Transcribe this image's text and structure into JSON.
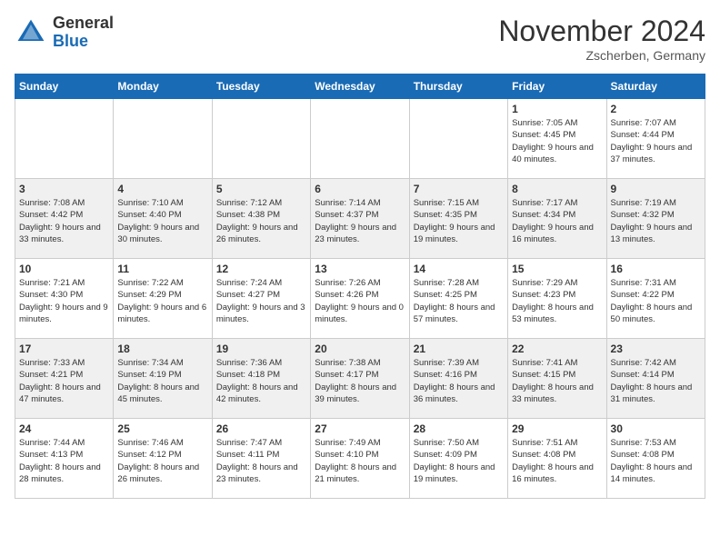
{
  "header": {
    "logo_general": "General",
    "logo_blue": "Blue",
    "month_title": "November 2024",
    "subtitle": "Zscherben, Germany"
  },
  "days_of_week": [
    "Sunday",
    "Monday",
    "Tuesday",
    "Wednesday",
    "Thursday",
    "Friday",
    "Saturday"
  ],
  "weeks": [
    [
      {
        "day": "",
        "info": ""
      },
      {
        "day": "",
        "info": ""
      },
      {
        "day": "",
        "info": ""
      },
      {
        "day": "",
        "info": ""
      },
      {
        "day": "",
        "info": ""
      },
      {
        "day": "1",
        "info": "Sunrise: 7:05 AM\nSunset: 4:45 PM\nDaylight: 9 hours\nand 40 minutes."
      },
      {
        "day": "2",
        "info": "Sunrise: 7:07 AM\nSunset: 4:44 PM\nDaylight: 9 hours\nand 37 minutes."
      }
    ],
    [
      {
        "day": "3",
        "info": "Sunrise: 7:08 AM\nSunset: 4:42 PM\nDaylight: 9 hours\nand 33 minutes."
      },
      {
        "day": "4",
        "info": "Sunrise: 7:10 AM\nSunset: 4:40 PM\nDaylight: 9 hours\nand 30 minutes."
      },
      {
        "day": "5",
        "info": "Sunrise: 7:12 AM\nSunset: 4:38 PM\nDaylight: 9 hours\nand 26 minutes."
      },
      {
        "day": "6",
        "info": "Sunrise: 7:14 AM\nSunset: 4:37 PM\nDaylight: 9 hours\nand 23 minutes."
      },
      {
        "day": "7",
        "info": "Sunrise: 7:15 AM\nSunset: 4:35 PM\nDaylight: 9 hours\nand 19 minutes."
      },
      {
        "day": "8",
        "info": "Sunrise: 7:17 AM\nSunset: 4:34 PM\nDaylight: 9 hours\nand 16 minutes."
      },
      {
        "day": "9",
        "info": "Sunrise: 7:19 AM\nSunset: 4:32 PM\nDaylight: 9 hours\nand 13 minutes."
      }
    ],
    [
      {
        "day": "10",
        "info": "Sunrise: 7:21 AM\nSunset: 4:30 PM\nDaylight: 9 hours\nand 9 minutes."
      },
      {
        "day": "11",
        "info": "Sunrise: 7:22 AM\nSunset: 4:29 PM\nDaylight: 9 hours\nand 6 minutes."
      },
      {
        "day": "12",
        "info": "Sunrise: 7:24 AM\nSunset: 4:27 PM\nDaylight: 9 hours\nand 3 minutes."
      },
      {
        "day": "13",
        "info": "Sunrise: 7:26 AM\nSunset: 4:26 PM\nDaylight: 9 hours\nand 0 minutes."
      },
      {
        "day": "14",
        "info": "Sunrise: 7:28 AM\nSunset: 4:25 PM\nDaylight: 8 hours\nand 57 minutes."
      },
      {
        "day": "15",
        "info": "Sunrise: 7:29 AM\nSunset: 4:23 PM\nDaylight: 8 hours\nand 53 minutes."
      },
      {
        "day": "16",
        "info": "Sunrise: 7:31 AM\nSunset: 4:22 PM\nDaylight: 8 hours\nand 50 minutes."
      }
    ],
    [
      {
        "day": "17",
        "info": "Sunrise: 7:33 AM\nSunset: 4:21 PM\nDaylight: 8 hours\nand 47 minutes."
      },
      {
        "day": "18",
        "info": "Sunrise: 7:34 AM\nSunset: 4:19 PM\nDaylight: 8 hours\nand 45 minutes."
      },
      {
        "day": "19",
        "info": "Sunrise: 7:36 AM\nSunset: 4:18 PM\nDaylight: 8 hours\nand 42 minutes."
      },
      {
        "day": "20",
        "info": "Sunrise: 7:38 AM\nSunset: 4:17 PM\nDaylight: 8 hours\nand 39 minutes."
      },
      {
        "day": "21",
        "info": "Sunrise: 7:39 AM\nSunset: 4:16 PM\nDaylight: 8 hours\nand 36 minutes."
      },
      {
        "day": "22",
        "info": "Sunrise: 7:41 AM\nSunset: 4:15 PM\nDaylight: 8 hours\nand 33 minutes."
      },
      {
        "day": "23",
        "info": "Sunrise: 7:42 AM\nSunset: 4:14 PM\nDaylight: 8 hours\nand 31 minutes."
      }
    ],
    [
      {
        "day": "24",
        "info": "Sunrise: 7:44 AM\nSunset: 4:13 PM\nDaylight: 8 hours\nand 28 minutes."
      },
      {
        "day": "25",
        "info": "Sunrise: 7:46 AM\nSunset: 4:12 PM\nDaylight: 8 hours\nand 26 minutes."
      },
      {
        "day": "26",
        "info": "Sunrise: 7:47 AM\nSunset: 4:11 PM\nDaylight: 8 hours\nand 23 minutes."
      },
      {
        "day": "27",
        "info": "Sunrise: 7:49 AM\nSunset: 4:10 PM\nDaylight: 8 hours\nand 21 minutes."
      },
      {
        "day": "28",
        "info": "Sunrise: 7:50 AM\nSunset: 4:09 PM\nDaylight: 8 hours\nand 19 minutes."
      },
      {
        "day": "29",
        "info": "Sunrise: 7:51 AM\nSunset: 4:08 PM\nDaylight: 8 hours\nand 16 minutes."
      },
      {
        "day": "30",
        "info": "Sunrise: 7:53 AM\nSunset: 4:08 PM\nDaylight: 8 hours\nand 14 minutes."
      }
    ]
  ]
}
